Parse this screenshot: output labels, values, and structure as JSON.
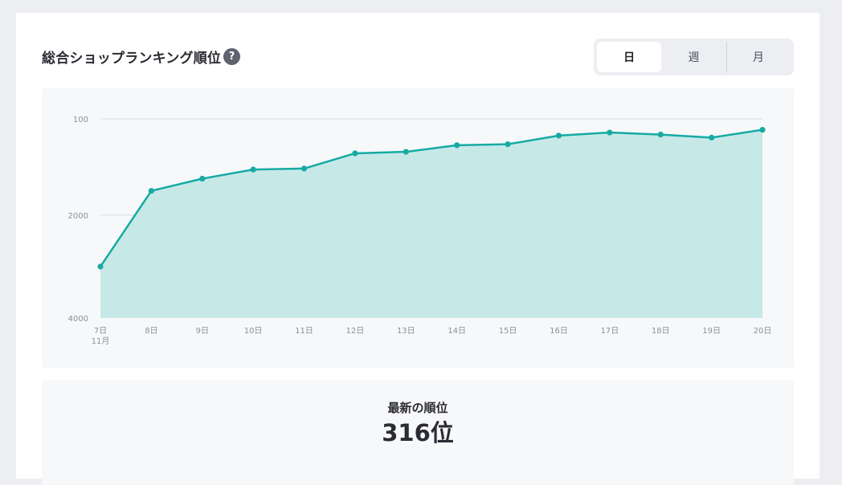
{
  "header": {
    "title": "総合ショップランキング順位",
    "help_icon_glyph": "?"
  },
  "period_tabs": {
    "selected": "日",
    "items": [
      {
        "label": "日"
      },
      {
        "label": "週"
      },
      {
        "label": "月"
      }
    ]
  },
  "latest": {
    "label": "最新の順位",
    "value": "316位"
  },
  "chart_data": {
    "type": "area",
    "title": "総合ショップランキング順位",
    "xlabel": "",
    "ylabel": "",
    "y_inverted": true,
    "y_ticks": [
      100,
      2000,
      4000
    ],
    "ylim": [
      100,
      4000
    ],
    "grid": "horizontal",
    "legend": "none",
    "categories": [
      "7日",
      "8日",
      "9日",
      "10日",
      "11日",
      "12日",
      "13日",
      "14日",
      "15日",
      "16日",
      "17日",
      "18日",
      "19日",
      "20日"
    ],
    "month_label": "11月",
    "series": [
      {
        "values": [
          3000,
          1520,
          1280,
          1100,
          1080,
          780,
          750,
          620,
          600,
          430,
          370,
          410,
          470,
          316
        ],
        "color": "#17aaa3",
        "fill": "#c6e9e8"
      }
    ]
  }
}
